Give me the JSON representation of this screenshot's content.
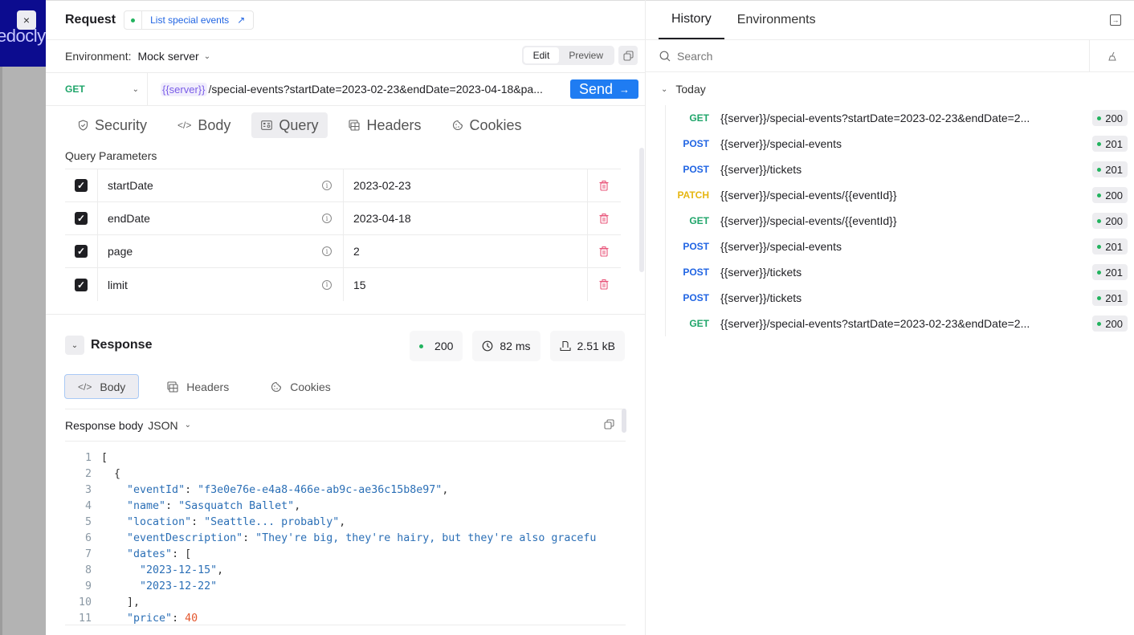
{
  "brand": {
    "text": "edocly",
    "close_label": "×"
  },
  "request": {
    "title": "Request",
    "operation_link": "List special events",
    "operation_link_icon": "↗",
    "environment_label": "Environment:",
    "environment_value": "Mock server",
    "mode_tabs": [
      "Edit",
      "Preview"
    ],
    "active_mode": "Edit",
    "method": "GET",
    "url_variable": "{{server}}",
    "url_path": "/special-events?startDate=2023-02-23&endDate=2023-04-18&pa...",
    "send_label": "Send",
    "tabs": [
      {
        "label": "Security",
        "icon": "shield-icon",
        "glyph": "⛉"
      },
      {
        "label": "Body",
        "icon": "code-icon",
        "glyph": "</>"
      },
      {
        "label": "Query",
        "icon": "query-icon",
        "glyph": "▣"
      },
      {
        "label": "Headers",
        "icon": "headers-icon",
        "glyph": "⊞"
      },
      {
        "label": "Cookies",
        "icon": "cookie-icon",
        "glyph": "◌"
      }
    ],
    "active_tab": "Query",
    "query_title": "Query Parameters",
    "query_params": [
      {
        "enabled": true,
        "name": "startDate",
        "value": "2023-02-23"
      },
      {
        "enabled": true,
        "name": "endDate",
        "value": "2023-04-18"
      },
      {
        "enabled": true,
        "name": "page",
        "value": "2"
      },
      {
        "enabled": true,
        "name": "limit",
        "value": "15"
      }
    ]
  },
  "response": {
    "title": "Response",
    "status": "200",
    "time": "82 ms",
    "size": "2.51 kB",
    "tabs": [
      {
        "label": "Body",
        "glyph": "</>"
      },
      {
        "label": "Headers",
        "glyph": "⊞"
      },
      {
        "label": "Cookies",
        "glyph": "◌"
      }
    ],
    "active_tab": "Body",
    "body_label": "Response body",
    "body_format": "JSON",
    "code_lines": [
      [
        [
          "p",
          "["
        ]
      ],
      [
        [
          "p",
          "  {"
        ]
      ],
      [
        [
          "k",
          "    \"eventId\""
        ],
        [
          "p",
          ": "
        ],
        [
          "s",
          "\"f3e0e76e-e4a8-466e-ab9c-ae36c15b8e97\""
        ],
        [
          "p",
          ","
        ]
      ],
      [
        [
          "k",
          "    \"name\""
        ],
        [
          "p",
          ": "
        ],
        [
          "s",
          "\"Sasquatch Ballet\""
        ],
        [
          "p",
          ","
        ]
      ],
      [
        [
          "k",
          "    \"location\""
        ],
        [
          "p",
          ": "
        ],
        [
          "s",
          "\"Seattle... probably\""
        ],
        [
          "p",
          ","
        ]
      ],
      [
        [
          "k",
          "    \"eventDescription\""
        ],
        [
          "p",
          ": "
        ],
        [
          "s",
          "\"They're big, they're hairy, but they're also gracefu"
        ]
      ],
      [
        [
          "k",
          "    \"dates\""
        ],
        [
          "p",
          ": ["
        ]
      ],
      [
        [
          "s",
          "      \"2023-12-15\""
        ],
        [
          "p",
          ","
        ]
      ],
      [
        [
          "s",
          "      \"2023-12-22\""
        ]
      ],
      [
        [
          "p",
          "    ],"
        ]
      ],
      [
        [
          "k",
          "    \"price\""
        ],
        [
          "p",
          ": "
        ],
        [
          "n",
          "40"
        ]
      ]
    ]
  },
  "history": {
    "tabs": [
      "History",
      "Environments"
    ],
    "active_tab": "History",
    "search_placeholder": "Search",
    "group_label": "Today",
    "items": [
      {
        "method": "GET",
        "url": "{{server}}/special-events?startDate=2023-02-23&endDate=2...",
        "status": "200"
      },
      {
        "method": "POST",
        "url": "{{server}}/special-events",
        "status": "201"
      },
      {
        "method": "POST",
        "url": "{{server}}/tickets",
        "status": "201"
      },
      {
        "method": "PATCH",
        "url": "{{server}}/special-events/{{eventId}}",
        "status": "200"
      },
      {
        "method": "GET",
        "url": "{{server}}/special-events/{{eventId}}",
        "status": "200"
      },
      {
        "method": "POST",
        "url": "{{server}}/special-events",
        "status": "201"
      },
      {
        "method": "POST",
        "url": "{{server}}/tickets",
        "status": "201"
      },
      {
        "method": "POST",
        "url": "{{server}}/tickets",
        "status": "201"
      },
      {
        "method": "GET",
        "url": "{{server}}/special-events?startDate=2023-02-23&endDate=2...",
        "status": "200"
      }
    ]
  },
  "colors": {
    "success": "#22b35e",
    "get": "#1fa56a",
    "post": "#2165e3",
    "patch": "#e6b611",
    "send_button": "#1f7cf2",
    "delete": "#e8557a",
    "brand_bg": "#0c0c8f"
  }
}
